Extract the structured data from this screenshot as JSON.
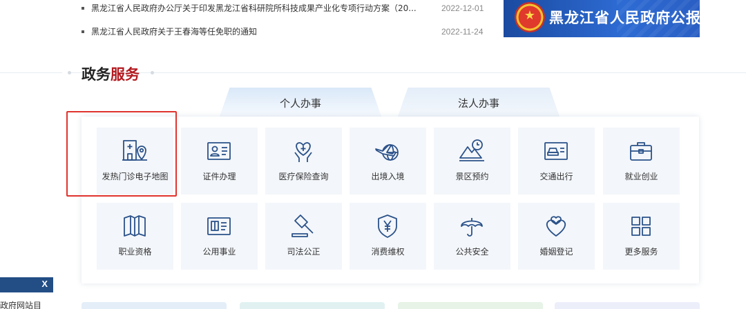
{
  "news": [
    {
      "title": "黑龙江省人民政府办公厅关于印发黑龙江省科研院所科技成果产业化专项行动方案（20...",
      "date": "2022-12-01"
    },
    {
      "title": "黑龙江省人民政府关于王春海等任免职的通知",
      "date": "2022-11-24"
    }
  ],
  "gazette": {
    "text": "黑龙江省人民政府公报",
    "icon": "national-emblem-icon"
  },
  "section": {
    "title_part1": "政务",
    "title_part2": "服务",
    "accent_color": "#b3191f"
  },
  "tabs": [
    {
      "label": "个人办事",
      "active": true
    },
    {
      "label": "法人办事",
      "active": false
    }
  ],
  "services": [
    {
      "label": "发热门诊电子地图",
      "icon": "hospital-location-icon"
    },
    {
      "label": "证件办理",
      "icon": "id-card-icon"
    },
    {
      "label": "医疗保险查询",
      "icon": "heart-hand-icon"
    },
    {
      "label": "出境入境",
      "icon": "plane-globe-icon"
    },
    {
      "label": "景区预约",
      "icon": "mountain-clock-icon"
    },
    {
      "label": "交通出行",
      "icon": "car-card-icon"
    },
    {
      "label": "就业创业",
      "icon": "briefcase-icon"
    },
    {
      "label": "职业资格",
      "icon": "book-icon"
    },
    {
      "label": "公用事业",
      "icon": "utility-card-icon"
    },
    {
      "label": "司法公正",
      "icon": "gavel-icon"
    },
    {
      "label": "消费维权",
      "icon": "shield-yuan-icon"
    },
    {
      "label": "公共安全",
      "icon": "umbrella-icon"
    },
    {
      "label": "婚姻登记",
      "icon": "hearts-icon"
    },
    {
      "label": "更多服务",
      "icon": "grid-icon"
    }
  ],
  "popup": {
    "close_label": "X",
    "text": "民政府网站目"
  },
  "colors": {
    "icon_stroke": "#2a5189",
    "tile_bg": "#f3f6fa",
    "highlight": "#e0322d",
    "popup_bar": "#234d85"
  }
}
